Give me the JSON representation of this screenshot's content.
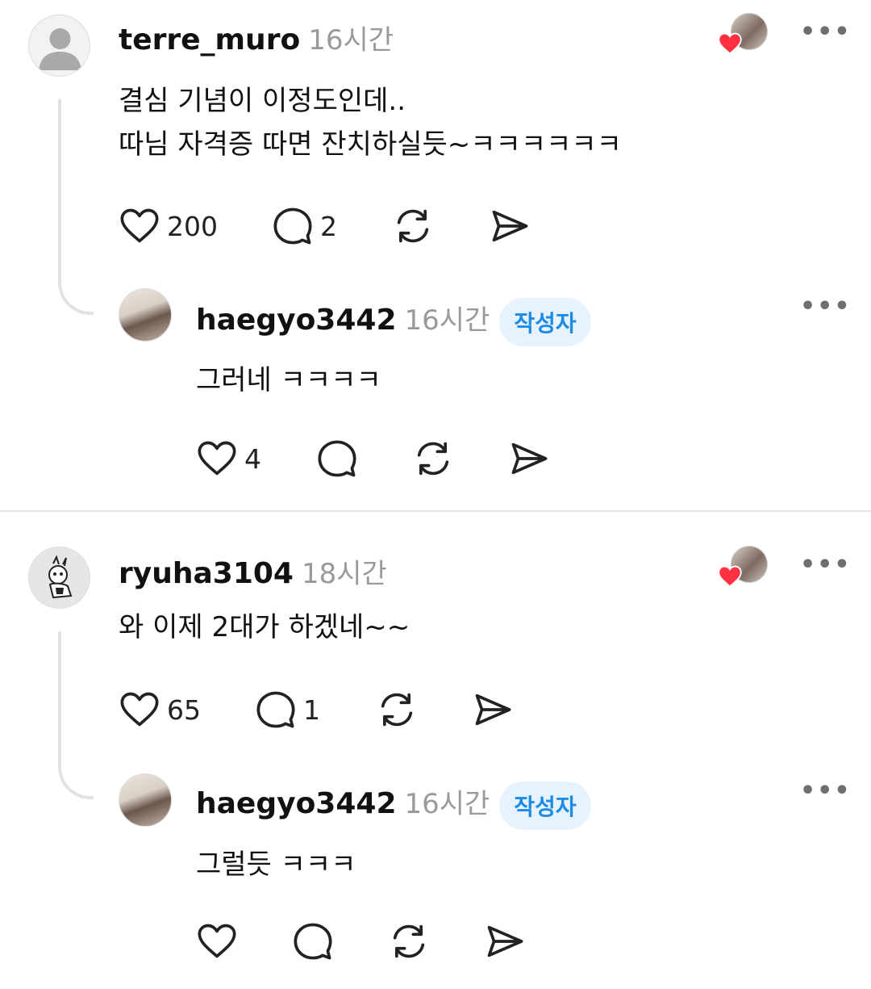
{
  "comments": [
    {
      "username": "terre_muro",
      "time": "16시간",
      "text": "결심 기념이 이정도인데..\n따님 자격증 따면 잔치하실듯~ㅋㅋㅋㅋㅋㅋ",
      "likes": "200",
      "replies": "2",
      "author_liked": true,
      "reply": {
        "username": "haegyo3442",
        "time": "16시간",
        "badge": "작성자",
        "text": "그러네 ㅋㅋㅋㅋ",
        "likes": "4"
      }
    },
    {
      "username": "ryuha3104",
      "time": "18시간",
      "text": "와 이제 2대가 하겠네~~",
      "likes": "65",
      "replies": "1",
      "author_liked": true,
      "reply": {
        "username": "haegyo3442",
        "time": "16시간",
        "badge": "작성자",
        "text": "그럴듯 ㅋㅋㅋ",
        "likes": ""
      }
    }
  ],
  "icons": {
    "like": "heart-outline-icon",
    "reply": "speech-bubble-icon",
    "repost": "repost-icon",
    "share": "send-icon",
    "more": "more-horizontal-icon",
    "author_like": "red-heart-icon"
  },
  "colors": {
    "accent_heart": "#ff3040",
    "badge_bg": "#e6f3fe",
    "badge_text": "#1d8ae3",
    "time": "#9a9a9a"
  },
  "more_label": "•••"
}
